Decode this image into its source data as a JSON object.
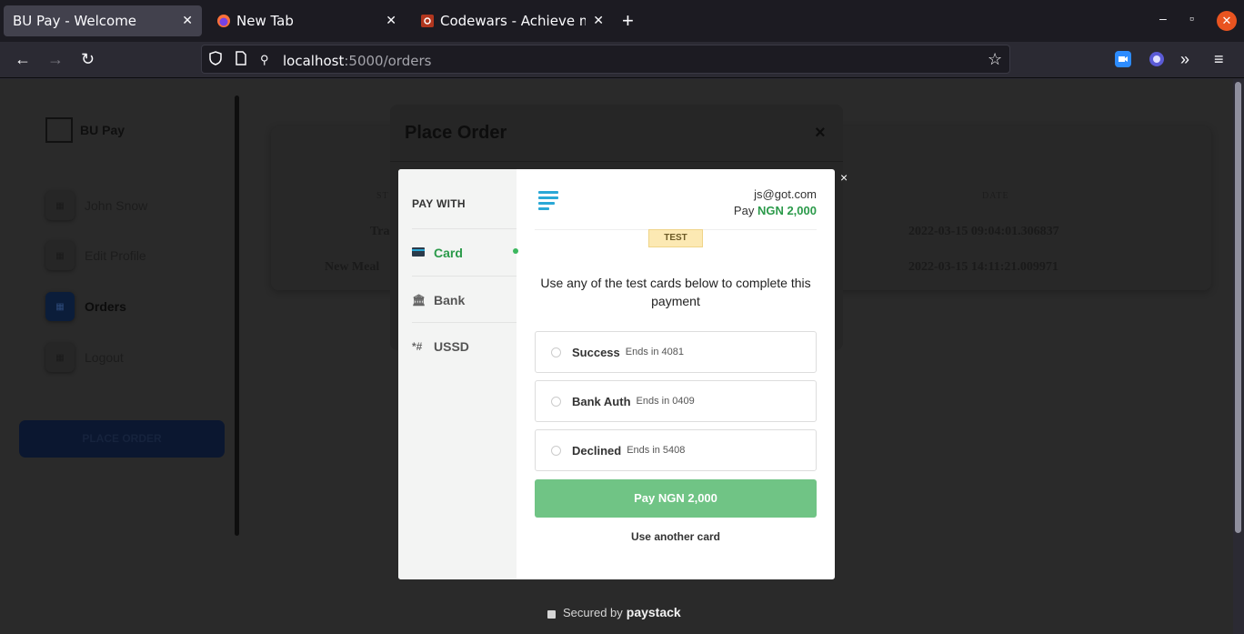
{
  "browser": {
    "tabs": [
      {
        "title": "BU Pay - Welcome",
        "close": "✕"
      },
      {
        "title": "New Tab",
        "close": "✕"
      },
      {
        "title": "Codewars - Achieve mast",
        "close": "✕"
      }
    ],
    "new_tab": "+",
    "url_host": "localhost",
    "url_path": ":5000/orders",
    "window_controls": {
      "minimize": "–",
      "maximize": "▫",
      "close": "✕"
    }
  },
  "app": {
    "brand": "BU Pay",
    "sidebar": {
      "items": [
        {
          "label": "John Snow"
        },
        {
          "label": "Edit Profile"
        },
        {
          "label": "Orders"
        },
        {
          "label": "Logout"
        }
      ],
      "place_order": "PLACE ORDER"
    },
    "table": {
      "headers": {
        "status": "ST",
        "date": "DATE"
      },
      "rows": [
        {
          "name": "Tra",
          "date": "2022-03-15 09:04:01.306837"
        },
        {
          "name": "New Meal",
          "date": "2022-03-15 14:11:21.009971"
        }
      ]
    },
    "modal": {
      "title": "Place Order",
      "close": "×"
    }
  },
  "paystack": {
    "close": "×",
    "pay_with": "PAY WITH",
    "methods": [
      {
        "label": "Card",
        "icon": "card-icon",
        "active": true
      },
      {
        "label": "Bank",
        "icon": "bank-icon",
        "active": false
      },
      {
        "label": "USSD",
        "icon": "ussd-icon",
        "icon_text": "*#",
        "active": false
      }
    ],
    "email": "js@got.com",
    "amount_prefix": "Pay",
    "amount": "NGN 2,000",
    "test_badge": "TEST",
    "instructions": "Use any of the test cards below to complete this payment",
    "test_cards": [
      {
        "name": "Success",
        "ends": "Ends in 4081"
      },
      {
        "name": "Bank Auth",
        "ends": "Ends in 0409"
      },
      {
        "name": "Declined",
        "ends": "Ends in 5408"
      }
    ],
    "pay_button": "Pay NGN 2,000",
    "another_card": "Use another card",
    "secured_by": "Secured by",
    "secured_brand": "paystack"
  },
  "colors": {
    "accent_green": "#3bb75e",
    "pay_button": "#70c485",
    "paystack_blue": "#2aa8d6"
  }
}
